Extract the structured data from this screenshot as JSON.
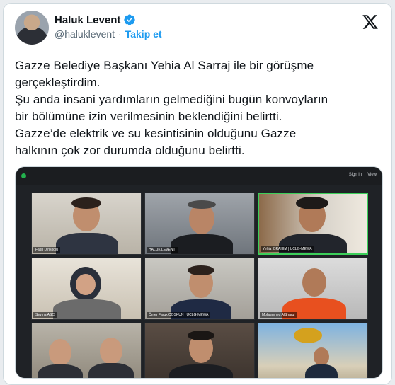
{
  "header": {
    "display_name": "Haluk Levent",
    "handle": "@haluklevent",
    "separator": "·",
    "follow_label": "Takip et"
  },
  "tweet": {
    "text": "Gazze Belediye Başkanı Yehia Al Sarraj ile bir görüşme\ngerçekleştirdim.\nŞu anda insani yardımların gelmediğini bugün konvoyların\nbir bölümüne izin verilmesinin beklendiğini belirtti.\nGazze’de elektrik ve su kesintisinin olduğunu Gazze\nhalkının çok zor durumda olduğunu belirtti."
  },
  "media": {
    "top_right": [
      "Sign in",
      "View"
    ],
    "tiles": [
      {
        "label": "Fatih Dirikoğlu",
        "active": false
      },
      {
        "label": "HALUK LEVENT",
        "active": false
      },
      {
        "label": "Yehia IBRAHIM | UCLG-MEWA",
        "active": true
      },
      {
        "label": "Şeyma AŞÇI",
        "active": false
      },
      {
        "label": "Ömer Faruk COŞKUN | UCLG-MEWA",
        "active": false
      },
      {
        "label": "Mohammed AlSharqi",
        "active": false
      },
      {
        "label": "",
        "active": false
      },
      {
        "label": "",
        "active": false
      },
      {
        "label": "",
        "active": false
      }
    ]
  },
  "colors": {
    "accent": "#1d9bf0",
    "verified": "#1d9bf0",
    "zoom_active": "#3ccf5a"
  },
  "icons": [
    "verified-badge-icon",
    "x-logo-icon"
  ]
}
